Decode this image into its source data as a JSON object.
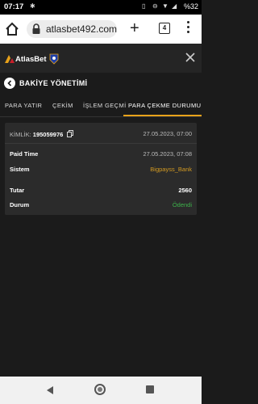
{
  "status_bar": {
    "time": "07:17",
    "battery": "%32"
  },
  "browser": {
    "url": "atlasbet492.com",
    "tab_count": "4"
  },
  "app": {
    "brand": "AtlasBet"
  },
  "page": {
    "title": "BAKİYE YÖNETİMİ"
  },
  "tabs": [
    {
      "label": "PARA YATIR"
    },
    {
      "label": "ÇEKİM"
    },
    {
      "label": "İŞLEM GEÇMİ"
    },
    {
      "label": "PARA ÇEKME DURUMU",
      "active": true
    }
  ],
  "transaction": {
    "id_label": "KİMLİK:",
    "id_value": "195059976",
    "created": "27.05.2023, 07:00",
    "paid_time_label": "Paid Time",
    "paid_time": "27.05.2023, 07:08",
    "system_label": "Sistem",
    "system": "Bigpayss_Bank",
    "amount_label": "Tutar",
    "amount": "2560",
    "status_label": "Durum",
    "status": "Ödendi"
  },
  "colors": {
    "accent": "#e8a21a",
    "system": "#d49b22",
    "status_paid": "#3db34a",
    "background": "#1b1b1b",
    "card": "#2b2b2b"
  },
  "icons": [
    "home-icon",
    "lock-icon",
    "plus-icon",
    "tabs-icon",
    "menu-icon",
    "close-icon",
    "back-icon",
    "copy-icon"
  ]
}
